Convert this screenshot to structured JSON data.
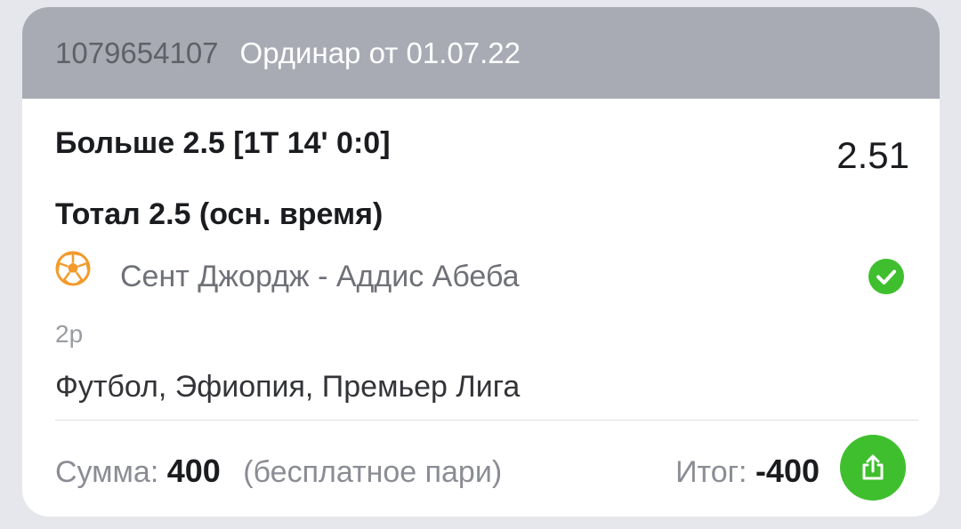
{
  "header": {
    "bet_id": "1079654107",
    "bet_type": "Ординар от 01.07.22"
  },
  "bet": {
    "selection": "Больше 2.5 [1Т 14' 0:0]",
    "odds": "2.51",
    "market": "Тотал 2.5 (осн. время)",
    "match": "Сент Джордж - Аддис Абеба",
    "period": "2р",
    "league": "Футбол, Эфиопия, Премьер Лига",
    "status_icon": "check-circle-icon",
    "sport_icon": "football-icon"
  },
  "footer": {
    "sum_label": "Сумма:",
    "sum_value": "400",
    "sum_note": "(бесплатное пари)",
    "total_label": "Итог:",
    "total_value": "-400",
    "share_icon": "share-icon"
  },
  "colors": {
    "header_bg": "#a9abb4",
    "accent_green": "#3fbf2e",
    "ball_orange": "#f39a2c"
  }
}
